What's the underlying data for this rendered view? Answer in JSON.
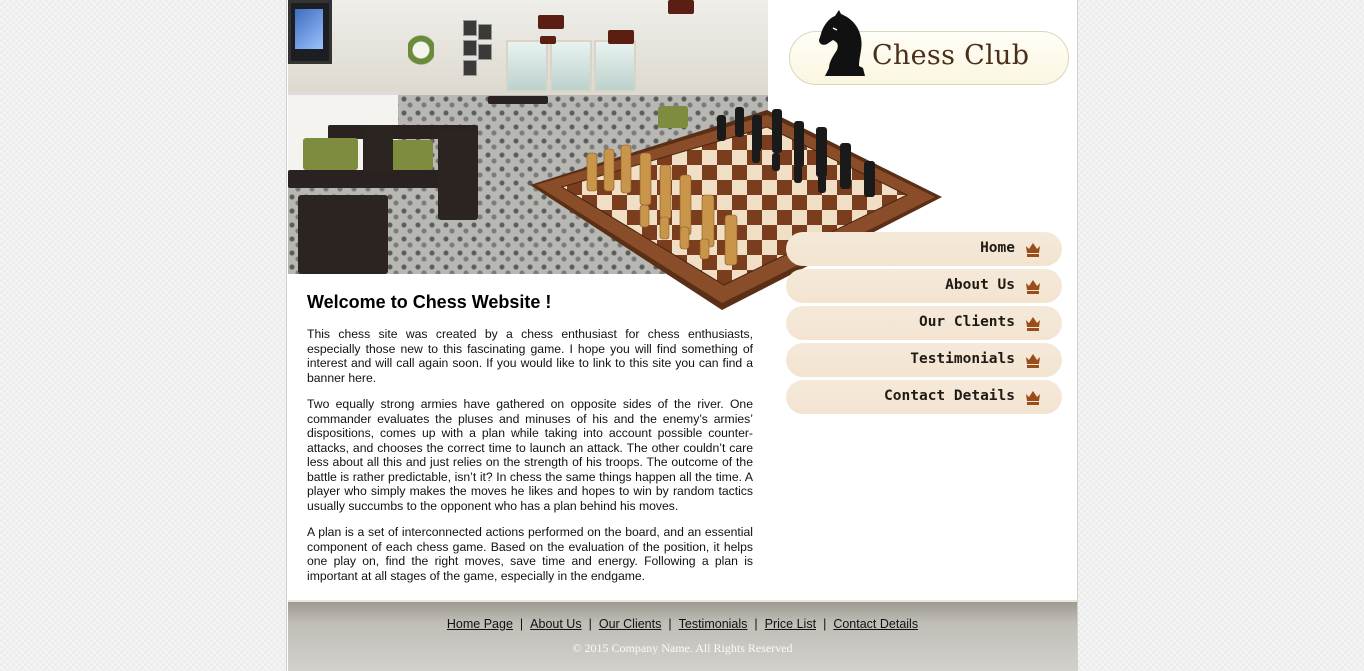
{
  "brand": {
    "title": "Chess Club"
  },
  "nav": {
    "items": [
      {
        "label": "Home"
      },
      {
        "label": "About Us"
      },
      {
        "label": "Our Clients"
      },
      {
        "label": "Testimonials"
      },
      {
        "label": "Contact Details"
      }
    ]
  },
  "content": {
    "heading": "Welcome to Chess Website !",
    "paragraphs": [
      "This chess site was created by a chess enthusiast for chess enthusiasts, especially those new to this fascinating game. I hope you will find something of interest and will call again soon. If you would like to link to this site you can find a banner here.",
      "Two equally strong armies have gathered on opposite sides of the river. One commander evaluates the pluses and minuses of his and the enemy’s armies’ dispositions, comes up with a plan while taking into account possible counter-attacks, and chooses the correct time to launch an attack. The other couldn’t care less about all this and just relies on the strength of his troops. The outcome of the battle is rather predictable, isn’t it? In chess the same things happen all the time. A player who simply makes the moves he likes and hopes to win by random tactics usually succumbs to the opponent who has a plan behind his moves.",
      "A plan is a set of interconnected actions performed on the board, and an essential component of each chess game. Based on the evaluation of the position, it helps one play on, find the right moves, save time and energy. Following a plan is important at all stages of the game, especially in the endgame."
    ]
  },
  "footer": {
    "links": [
      {
        "label": "Home Page"
      },
      {
        "label": "About Us"
      },
      {
        "label": "Our Clients"
      },
      {
        "label": "Testimonials"
      },
      {
        "label": "Price List"
      },
      {
        "label": "Contact Details"
      }
    ],
    "separator": "|",
    "copyright": "© 2015 Company Name. All Rights Reserved"
  },
  "icons": {
    "logo": "knight-icon",
    "nav_item": "crown-icon"
  },
  "colors": {
    "nav_background": "#f5e9d9",
    "logo_text": "#4a2f1c",
    "footer_background": "#bfbdb6"
  }
}
